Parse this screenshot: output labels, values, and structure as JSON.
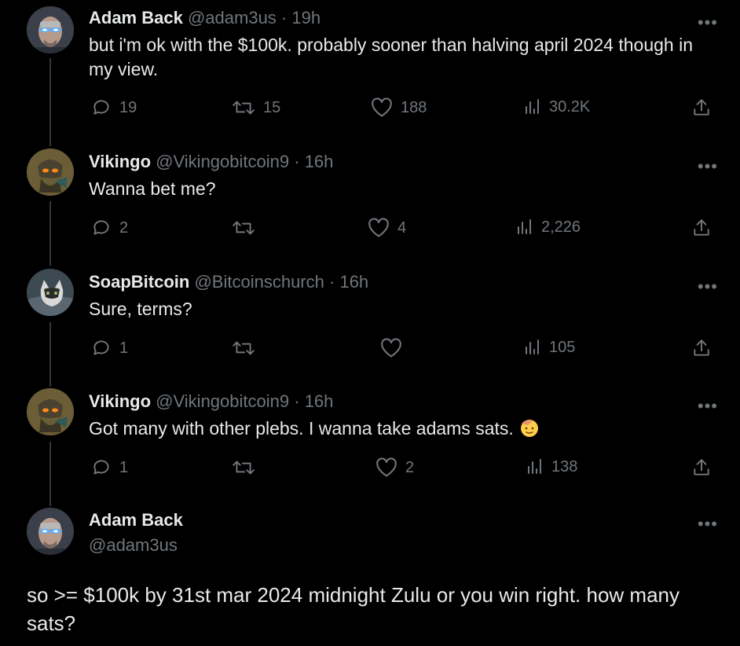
{
  "tweets": [
    {
      "name": "Adam Back",
      "handle": "@adam3us",
      "time": "19h",
      "text": "but i'm ok with the $100k. probably sooner than halving april 2024 though in my view.",
      "replies": "19",
      "retweets": "15",
      "likes": "188",
      "views": "30.2K",
      "avatar": "laser-eyes-avatar"
    },
    {
      "name": "Vikingo",
      "handle": "@Vikingobitcoin9",
      "time": "16h",
      "text": "Wanna bet me?",
      "replies": "2",
      "retweets": "",
      "likes": "4",
      "views": "2,226",
      "avatar": "viking-avatar"
    },
    {
      "name": "SoapBitcoin",
      "handle": "@Bitcoinschurch",
      "time": "16h",
      "text": "Sure, terms?",
      "replies": "1",
      "retweets": "",
      "likes": "",
      "views": "105",
      "avatar": "cat-avatar"
    },
    {
      "name": "Vikingo",
      "handle": "@Vikingobitcoin9",
      "time": "16h",
      "text": "Got many with other plebs. I wanna take adams sats.",
      "replies": "1",
      "retweets": "",
      "likes": "2",
      "views": "138",
      "avatar": "viking-avatar",
      "emoji": "saluting-face-emoji"
    }
  ],
  "main_tweet": {
    "name": "Adam Back",
    "handle": "@adam3us",
    "text": "so >= $100k by 31st mar 2024 midnight Zulu or you win right. how many sats?"
  },
  "separator": "·",
  "more_label": "•••",
  "colors": {
    "background": "#000000",
    "text": "#e7e9ea",
    "muted": "#71767b",
    "thread_line": "#333639"
  }
}
